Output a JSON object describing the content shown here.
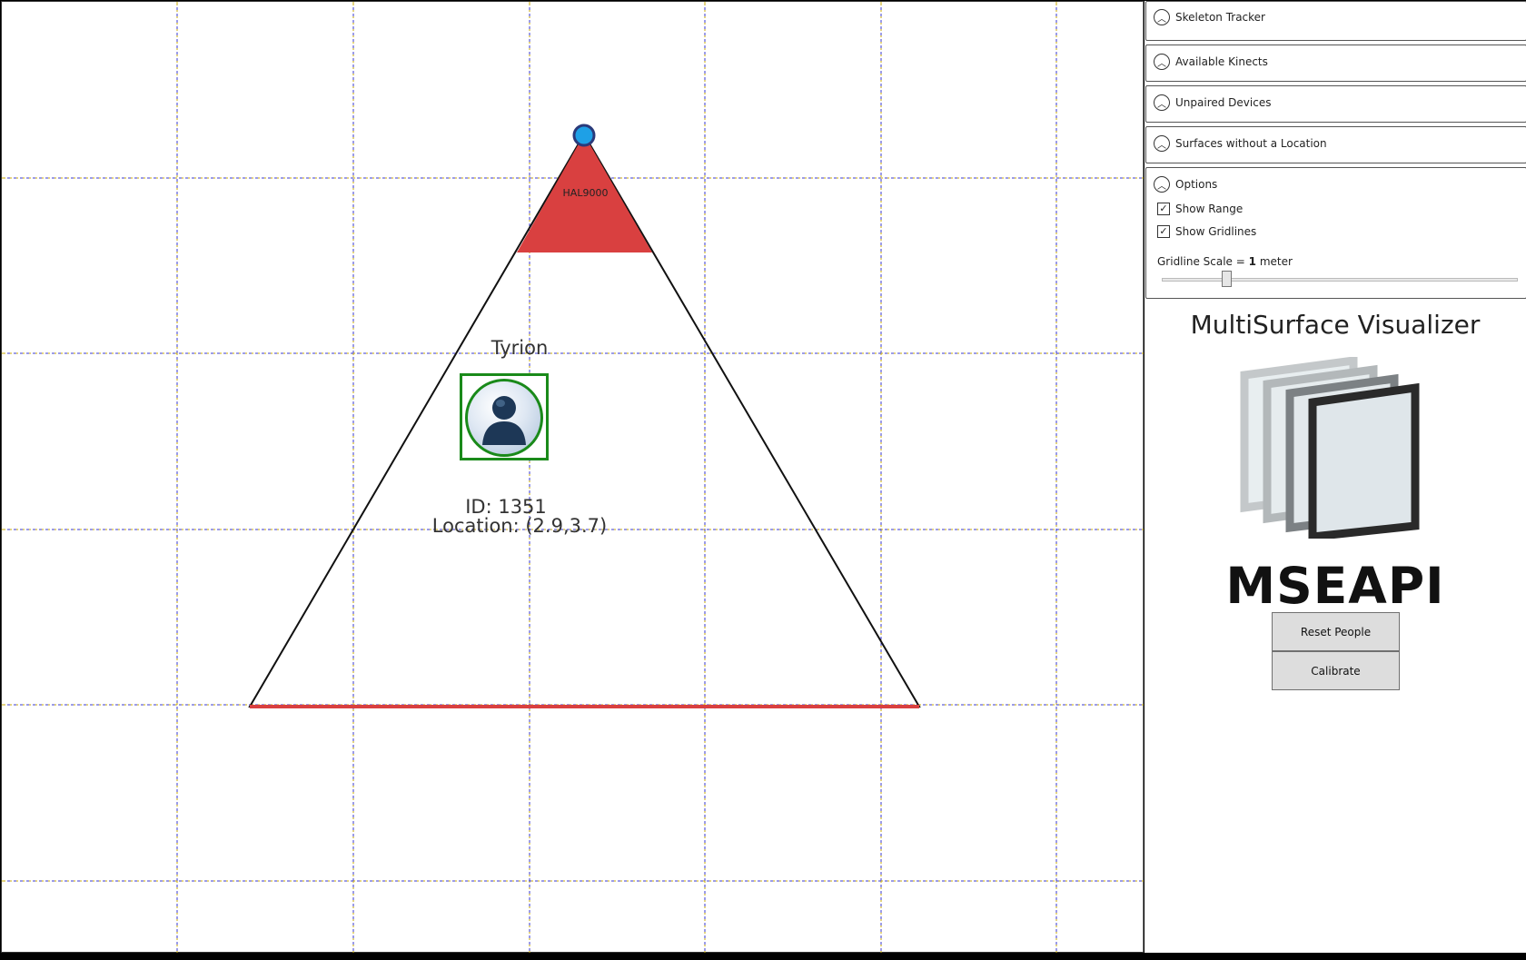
{
  "canvas": {
    "device_name": "HAL9000",
    "person": {
      "name": "Tyrion",
      "id_text": "ID: 1351",
      "location_text": "Location: (2.9,3.7)"
    },
    "colors": {
      "grid_line": "#c8a800",
      "grid_line_alt": "#3a3ad0",
      "range_fill": "#d94040",
      "device_dot": "#1ea0e6",
      "person_box": "#1a8a1a"
    }
  },
  "side_panel": {
    "expanders": [
      {
        "label": "Skeleton Tracker"
      },
      {
        "label": "Available Kinects"
      },
      {
        "label": "Unpaired Devices"
      },
      {
        "label": "Surfaces without a Location"
      }
    ],
    "options": {
      "label": "Options",
      "show_range": {
        "label": "Show Range",
        "checked": true
      },
      "show_gridlines": {
        "label": "Show Gridlines",
        "checked": true
      },
      "scale_prefix": "Gridline Scale = ",
      "scale_value": "1",
      "scale_unit": "meter"
    },
    "app_title": "MultiSurface Visualizer",
    "logo_text": "MSEAPI",
    "buttons": {
      "reset_people": "Reset People",
      "calibrate": "Calibrate"
    }
  }
}
